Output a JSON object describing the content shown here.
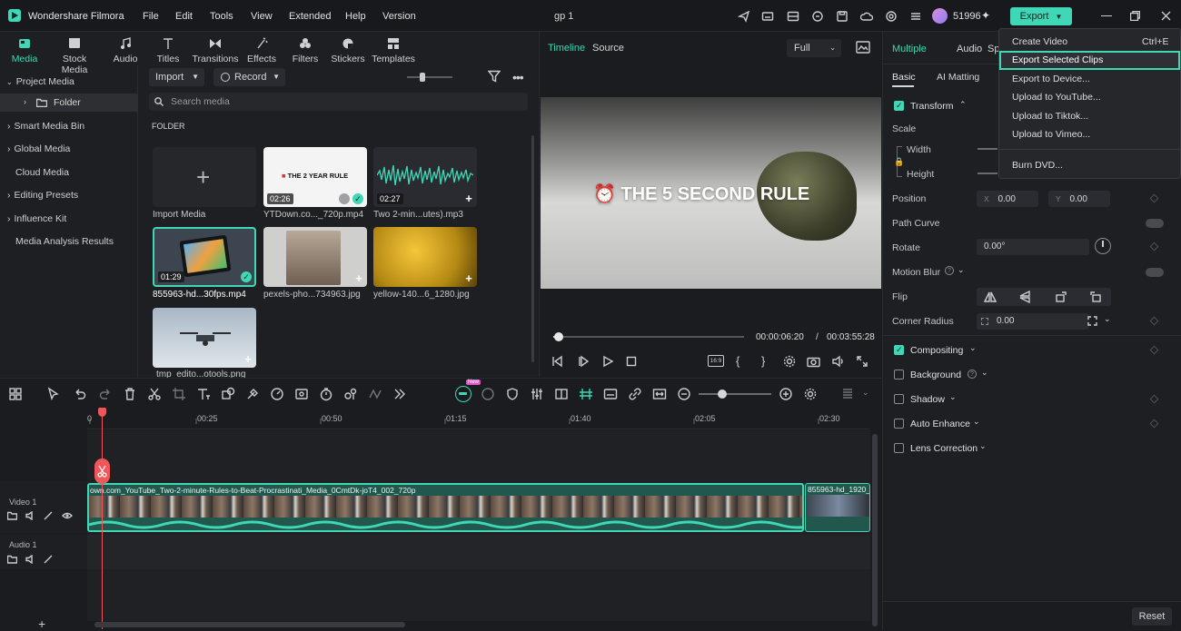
{
  "app": {
    "title": "Wondershare Filmora",
    "menus": [
      "File",
      "Edit",
      "Tools",
      "View",
      "Extended",
      "Help",
      "Version"
    ],
    "project_name": "gp 1",
    "credits": "51996",
    "export_label": "Export"
  },
  "media_tabs": [
    "Media",
    "Stock Media",
    "Audio",
    "Titles",
    "Transitions",
    "Effects",
    "Filters",
    "Stickers",
    "Templates"
  ],
  "sidebar": {
    "project_media": "Project Media",
    "folder": "Folder",
    "items": [
      "Smart Media Bin",
      "Global Media",
      "Cloud Media",
      "Editing Presets",
      "Influence Kit",
      "Media Analysis Results"
    ]
  },
  "library": {
    "import_label": "Import",
    "record_label": "Record",
    "search_placeholder": "Search media",
    "folder_heading": "FOLDER",
    "import_media_label": "Import Media",
    "items": [
      {
        "name": "YTDown.co..._720p.mp4",
        "duration": "02:26",
        "thumb_text": "THE 2 YEAR RULE"
      },
      {
        "name": "Two 2-min...utes).mp3",
        "duration": "02:27"
      },
      {
        "name": "855963-hd...30fps.mp4",
        "duration": "01:29"
      },
      {
        "name": "pexels-pho...734963.jpg"
      },
      {
        "name": "yellow-140...6_1280.jpg"
      },
      {
        "name": "tmp_edito...otools.png"
      }
    ]
  },
  "preview": {
    "tab_timeline": "Timeline",
    "tab_source": "Source",
    "quality": "Full",
    "overlay_title": "THE 5 SECOND RULE",
    "current_time": "00:00:06:20",
    "separator": "/",
    "total_time": "00:03:55:28",
    "progress": 0.03,
    "ratio_label": "16:9"
  },
  "properties": {
    "tabs": [
      "Multiple",
      "Audio",
      "Sp"
    ],
    "subtabs": [
      "Basic",
      "AI Matting"
    ],
    "transform": "Transform",
    "scale": "Scale",
    "width": "Width",
    "height": "Height",
    "position": "Position",
    "pos_x_label": "X",
    "pos_x": "0.00",
    "pos_y_label": "Y",
    "pos_y": "0.00",
    "path_curve": "Path Curve",
    "rotate": "Rotate",
    "rotate_value": "0.00°",
    "motion_blur": "Motion Blur",
    "flip": "Flip",
    "corner_radius": "Corner Radius",
    "corner_value": "0.00",
    "compositing": "Compositing",
    "background": "Background",
    "shadow": "Shadow",
    "auto_enhance": "Auto Enhance",
    "lens_correction": "Lens Correction",
    "reset": "Reset"
  },
  "export_menu": {
    "items": [
      "Create Video",
      "Export Selected Clips",
      "Export to Device...",
      "Upload to YouTube...",
      "Upload to Tiktok...",
      "Upload to Vimeo...",
      "Burn DVD..."
    ],
    "shortcut": "Ctrl+E",
    "highlighted": "Export Selected Clips"
  },
  "timeline": {
    "ruler": [
      "0",
      "00:25",
      "00:50",
      "01:15",
      "01:40",
      "02:05",
      "02:30"
    ],
    "video_track": "Video 1",
    "audio_track": "Audio 1",
    "clip1_name": "own.com_YouTube_Two-2-minute-Rules-to-Beat-Procrastinati_Media_0CmtDk-joT4_002_720p",
    "clip2_name": "855963-hd_1920_",
    "new_badge": "New"
  },
  "colors": {
    "accent": "#3fd7b5",
    "playhead": "#f0575a",
    "clip": "#2a8e78"
  }
}
